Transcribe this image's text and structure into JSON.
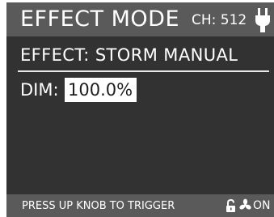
{
  "header": {
    "title": "EFFECT MODE",
    "channel": "CH: 512",
    "power_icon": "plug-icon"
  },
  "effect": {
    "text": "EFFECT: STORM MANUAL"
  },
  "dim": {
    "label": "DIM:",
    "value": "100.0%"
  },
  "footer": {
    "hint": "PRESS UP KNOB TO TRIGGER",
    "lock_icon": "unlocked-padlock-icon",
    "fan_icon": "fan-icon",
    "fan_status": "ON"
  },
  "colors": {
    "screen_background": "#323232",
    "bar_background": "#5a5a5a",
    "text": "#ffffff",
    "highlight_background": "#ffffff",
    "highlight_text": "#1e1e1e"
  }
}
